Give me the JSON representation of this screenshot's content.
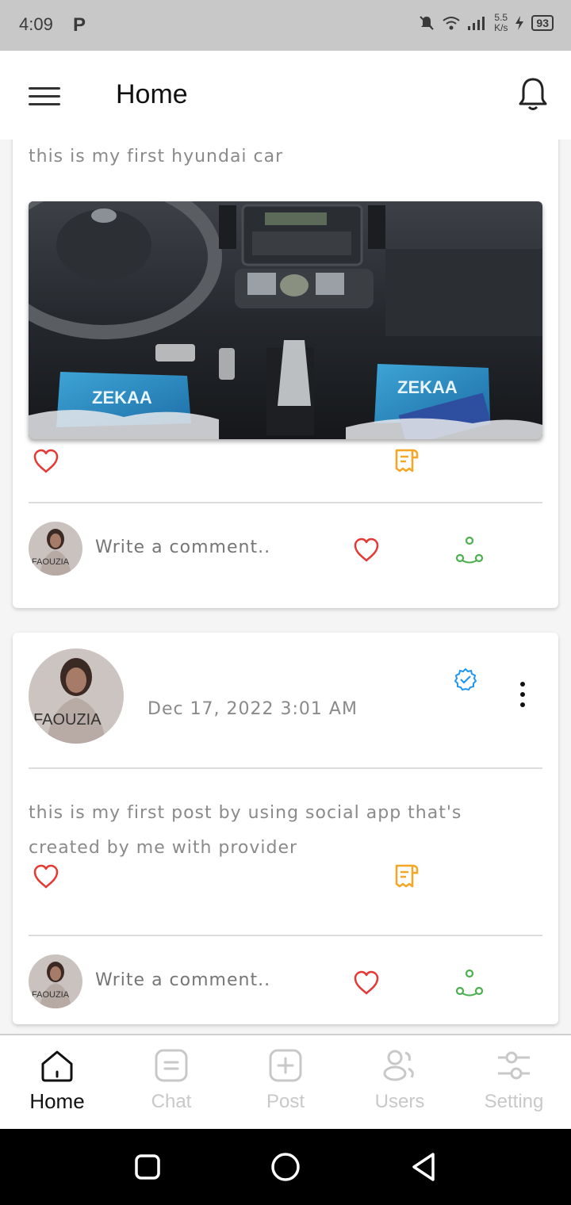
{
  "status_bar": {
    "time": "4:09",
    "p_glyph": "P",
    "speed_top": "5.5",
    "speed_bottom": "K/s",
    "battery": "93"
  },
  "app_bar": {
    "title": "Home",
    "menu_icon": "hamburger-icon",
    "notification_icon": "bell-icon"
  },
  "posts": [
    {
      "text": "this is my first  hyundai car",
      "image_alt": "Hyundai car interior dashboard with ZEKAA floor mats",
      "mat_label_left": "ZEKAA",
      "mat_label_right": "ZEKAA",
      "comment_placeholder": "Write a comment.."
    },
    {
      "avatar_text": "FAOUZIA",
      "date": "Dec 17, 2022 3:01 AM",
      "text_line1": "this is my first post by using social app that's",
      "text_line2": "created by me with provider",
      "comment_placeholder": "Write a comment.."
    }
  ],
  "bottom_nav": [
    {
      "label": "Home",
      "icon": "home-icon",
      "active": true
    },
    {
      "label": "Chat",
      "icon": "chat-icon",
      "active": false
    },
    {
      "label": "Post",
      "icon": "add-post-icon",
      "active": false
    },
    {
      "label": "Users",
      "icon": "users-icon",
      "active": false
    },
    {
      "label": "Setting",
      "icon": "settings-sliders-icon",
      "active": false
    }
  ],
  "colors": {
    "like": "#e53935",
    "comment": "#f5a623",
    "share": "#4caf50",
    "verified": "#2196f3"
  }
}
